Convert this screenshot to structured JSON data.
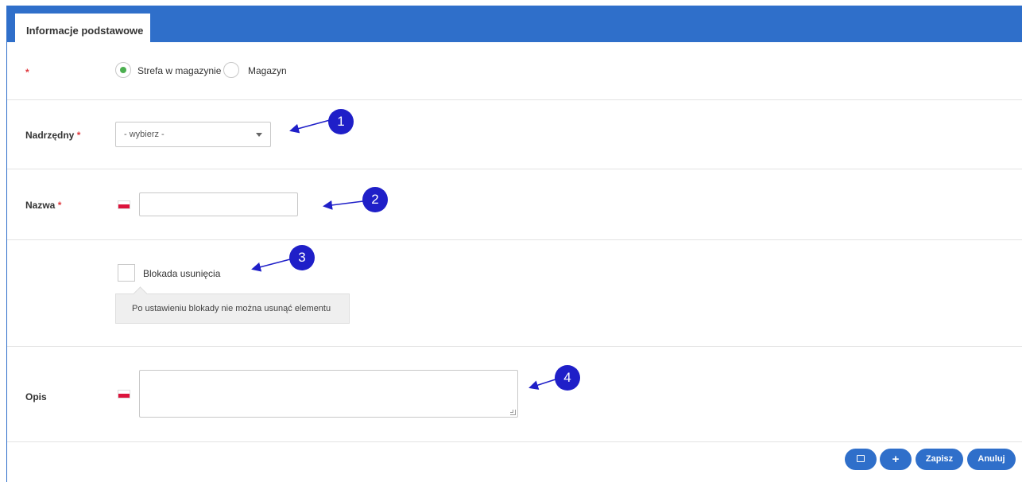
{
  "tabs": [
    {
      "label": "Informacje podstawowe"
    }
  ],
  "type_row": {
    "required_mark": "*",
    "options": [
      {
        "label": "Strefa w magazynie",
        "checked": true
      },
      {
        "label": "Magazyn",
        "checked": false
      }
    ]
  },
  "parent_row": {
    "label": "Nadrzędny",
    "required_mark": "*",
    "select_value": "- wybierz -",
    "badge": "1"
  },
  "name_row": {
    "label": "Nazwa",
    "required_mark": "*",
    "value": "",
    "badge": "2"
  },
  "lock_row": {
    "checkbox_label": "Blokada usunięcia",
    "checked": false,
    "tooltip": "Po ustawieniu blokady nie można usunąć elementu",
    "badge": "3"
  },
  "desc_row": {
    "label": "Opis",
    "value": "",
    "badge": "4"
  },
  "footer": {
    "save_label": "Zapisz",
    "cancel_label": "Anuluj",
    "add_icon": "plus-icon",
    "back_icon": "save-back-icon"
  },
  "colors": {
    "primary": "#2f6fca",
    "required": "#e0393e",
    "radio_checked": "#4caf50",
    "badge": "#1f1fc8",
    "arrow": "#1f1fc8"
  }
}
